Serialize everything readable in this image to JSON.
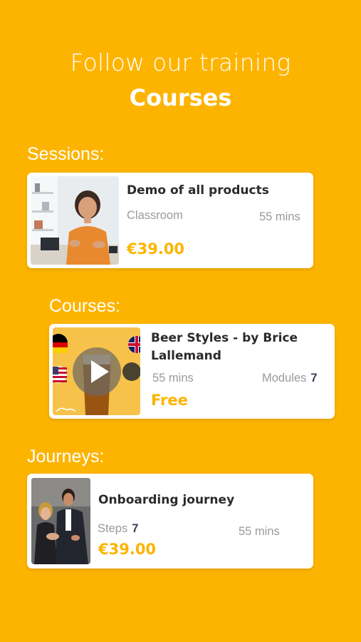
{
  "hero": {
    "line1": "Follow our training",
    "line2": "Courses"
  },
  "sessions": {
    "label": "Sessions:",
    "item": {
      "title": "Demo of all products",
      "type": "Classroom",
      "duration": "55 mins",
      "price": "€39.00"
    }
  },
  "courses": {
    "label": "Courses:",
    "item": {
      "title": "Beer Styles - by Brice Lallemand",
      "duration": "55 mins",
      "modules_label": "Modules",
      "modules_count": "7",
      "price": "Free"
    }
  },
  "journeys": {
    "label": "Journeys:",
    "item": {
      "title": "Onboarding journey",
      "steps_label": "Steps",
      "steps_count": "7",
      "duration": "55 mins",
      "price": "€39.00"
    }
  },
  "colors": {
    "background": "#FDB400",
    "accent": "#FDB400",
    "card": "#FFFFFF"
  }
}
